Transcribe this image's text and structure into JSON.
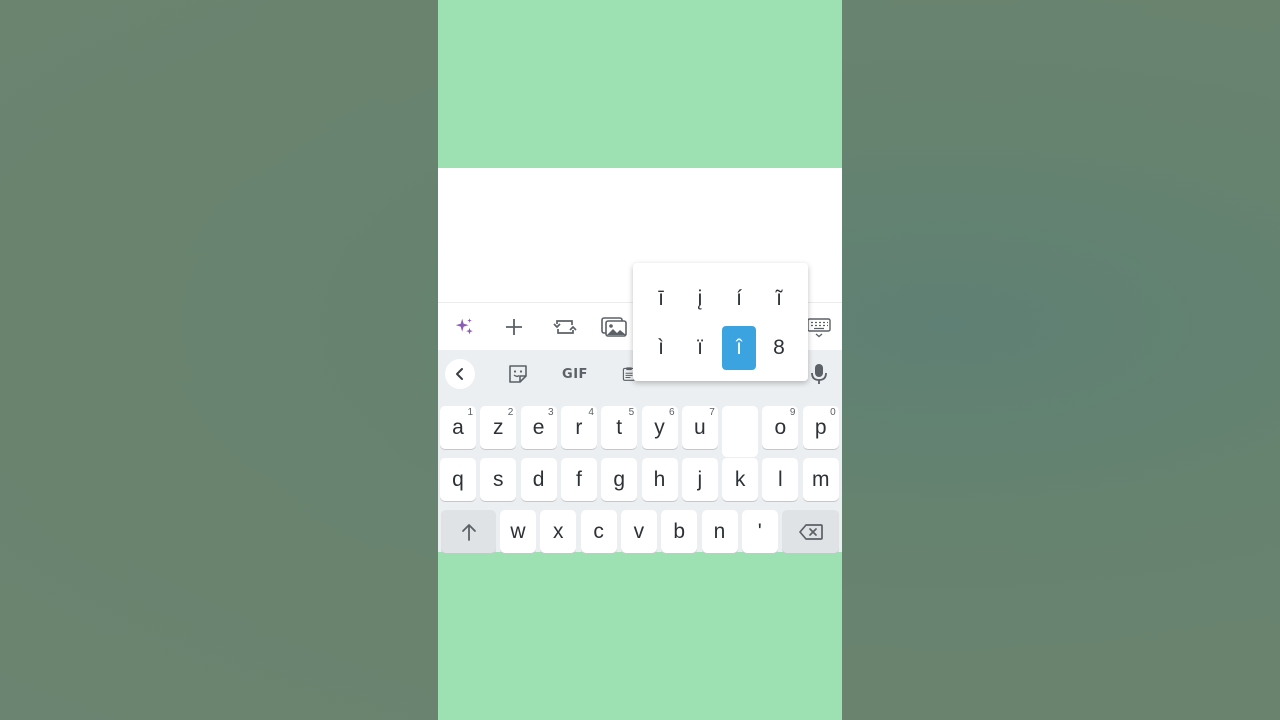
{
  "toolbar": {
    "icons": [
      "sparkle-icon",
      "plus-icon",
      "repost-icon",
      "image-icon",
      "keyboard-icon"
    ]
  },
  "suggestions": {
    "gif_label": "GIF",
    "icons": [
      "back-chevron-icon",
      "sticker-icon",
      "clipboard-icon",
      "microphone-icon"
    ]
  },
  "keyboard": {
    "row1": [
      {
        "label": "a",
        "hint": "1"
      },
      {
        "label": "z",
        "hint": "2"
      },
      {
        "label": "e",
        "hint": "3"
      },
      {
        "label": "r",
        "hint": "4"
      },
      {
        "label": "t",
        "hint": "5"
      },
      {
        "label": "y",
        "hint": "6"
      },
      {
        "label": "u",
        "hint": "7"
      },
      {
        "label": "",
        "hint": ""
      },
      {
        "label": "o",
        "hint": "9"
      },
      {
        "label": "p",
        "hint": "0"
      }
    ],
    "row2": [
      "q",
      "s",
      "d",
      "f",
      "g",
      "h",
      "j",
      "k",
      "l",
      "m"
    ],
    "row3": [
      "w",
      "x",
      "c",
      "v",
      "b",
      "n",
      "'"
    ],
    "shift_icon": "shift-arrow-icon",
    "backspace_icon": "backspace-icon"
  },
  "accent_popup": {
    "row1": [
      "ī",
      "į",
      "í",
      "ĩ"
    ],
    "row2": [
      "ì",
      "ï",
      "î",
      "8"
    ],
    "selected": "î"
  },
  "colors": {
    "phone_background": "#9de0b1",
    "selected_accent": "#3ba4e0",
    "sparkle": "#8b5bb8"
  }
}
